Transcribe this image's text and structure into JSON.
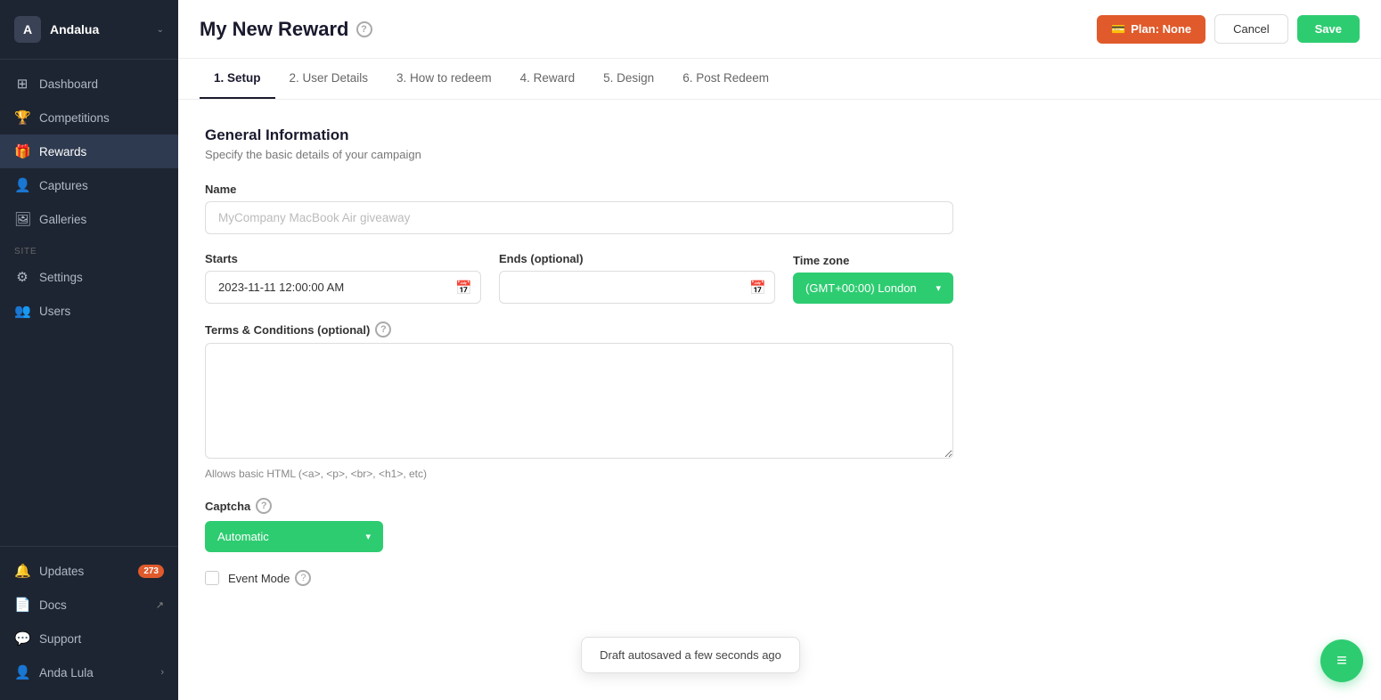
{
  "sidebar": {
    "logo": {
      "initial": "A",
      "name": "Andalua",
      "chevron": "⌄"
    },
    "nav_items": [
      {
        "id": "dashboard",
        "label": "Dashboard",
        "icon": "⊞",
        "active": false
      },
      {
        "id": "competitions",
        "label": "Competitions",
        "icon": "🏆",
        "active": false
      },
      {
        "id": "rewards",
        "label": "Rewards",
        "icon": "🎁",
        "active": true
      },
      {
        "id": "captures",
        "label": "Captures",
        "icon": "👤",
        "active": false
      },
      {
        "id": "galleries",
        "label": "Galleries",
        "icon": "🖼",
        "active": false
      }
    ],
    "site_section": "Site",
    "site_items": [
      {
        "id": "settings",
        "label": "Settings",
        "icon": "⚙"
      },
      {
        "id": "users",
        "label": "Users",
        "icon": "👥"
      }
    ],
    "bottom_items": [
      {
        "id": "updates",
        "label": "Updates",
        "icon": "🔔",
        "badge": "273"
      },
      {
        "id": "docs",
        "label": "Docs",
        "icon": "📄",
        "external": true
      },
      {
        "id": "support",
        "label": "Support",
        "icon": "💬"
      },
      {
        "id": "anda-lula",
        "label": "Anda Lula",
        "icon": "👤",
        "chevron": "›"
      }
    ]
  },
  "header": {
    "title": "My New Reward",
    "help_icon": "?",
    "plan_label": "Plan: None",
    "cancel_label": "Cancel",
    "save_label": "Save"
  },
  "tabs": [
    {
      "id": "setup",
      "label": "1. Setup",
      "active": true
    },
    {
      "id": "user-details",
      "label": "2. User Details",
      "active": false
    },
    {
      "id": "how-to-redeem",
      "label": "3. How to redeem",
      "active": false
    },
    {
      "id": "reward",
      "label": "4. Reward",
      "active": false
    },
    {
      "id": "design",
      "label": "5. Design",
      "active": false
    },
    {
      "id": "post-redeem",
      "label": "6. Post Redeem",
      "active": false
    }
  ],
  "form": {
    "section_title": "General Information",
    "section_subtitle": "Specify the basic details of your campaign",
    "name_label": "Name",
    "name_placeholder": "MyCompany MacBook Air giveaway",
    "starts_label": "Starts",
    "starts_value": "2023-11-11 12:00:00 AM",
    "ends_label": "Ends (optional)",
    "ends_value": "",
    "timezone_label": "Time zone",
    "timezone_value": "(GMT+00:00) London",
    "terms_label": "Terms & Conditions (optional)",
    "terms_help_icon": "?",
    "terms_value": "",
    "html_hint": "Allows basic HTML (<a>, <p>, <br>, <h1>, etc)",
    "captcha_label": "Captcha",
    "captcha_help_icon": "?",
    "captcha_value": "Automatic",
    "captcha_chevron": "▾",
    "event_mode_label": "Event Mode",
    "event_mode_help_icon": "?"
  },
  "toast": {
    "message": "Draft autosaved a few seconds ago"
  },
  "fab": {
    "icon": "≡"
  }
}
